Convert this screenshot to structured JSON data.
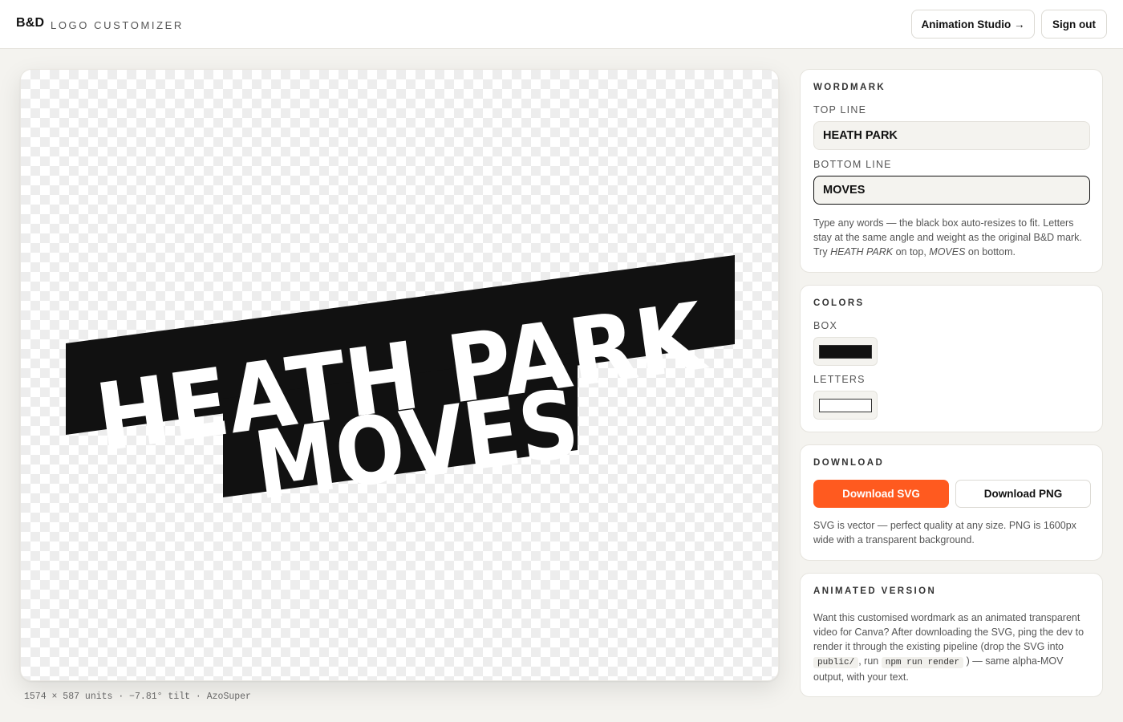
{
  "header": {
    "brand": "B&D",
    "subtitle": "LOGO CUSTOMIZER",
    "studio_button": "Animation Studio →",
    "signout_button": "Sign out"
  },
  "preview": {
    "top_line": "HEATH PARK",
    "bottom_line": "MOVES",
    "meta": "1574 × 587 units · −7.81° tilt · AzoSuper"
  },
  "wordmark": {
    "title": "WORDMARK",
    "top_label": "TOP LINE",
    "top_value": "HEATH PARK",
    "bottom_label": "BOTTOM LINE",
    "bottom_value": "MOVES",
    "help_1": "Type any words — the black box auto-resizes to fit. Letters stay at the same angle and weight as the original B&D mark. Try ",
    "help_em_1": "HEATH PARK",
    "help_2": " on top, ",
    "help_em_2": "MOVES",
    "help_3": " on bottom."
  },
  "colors": {
    "title": "COLORS",
    "box_label": "BOX",
    "box_color": "#111111",
    "letters_label": "LETTERS",
    "letters_color": "#ffffff"
  },
  "download": {
    "title": "DOWNLOAD",
    "svg_button": "Download SVG",
    "png_button": "Download PNG",
    "help": "SVG is vector — perfect quality at any size. PNG is 1600px wide with a transparent background.",
    "accent": "#ff5a1f"
  },
  "animated": {
    "title": "ANIMATED VERSION",
    "text_1": "Want this customised wordmark as an animated transparent video for Canva? After downloading the SVG, ping the dev to render it through the existing pipeline (drop the SVG into",
    "code_1": "public/",
    "text_2": ", run",
    "code_2": "npm run render",
    "text_3": ") — same alpha-MOV output, with your text."
  }
}
